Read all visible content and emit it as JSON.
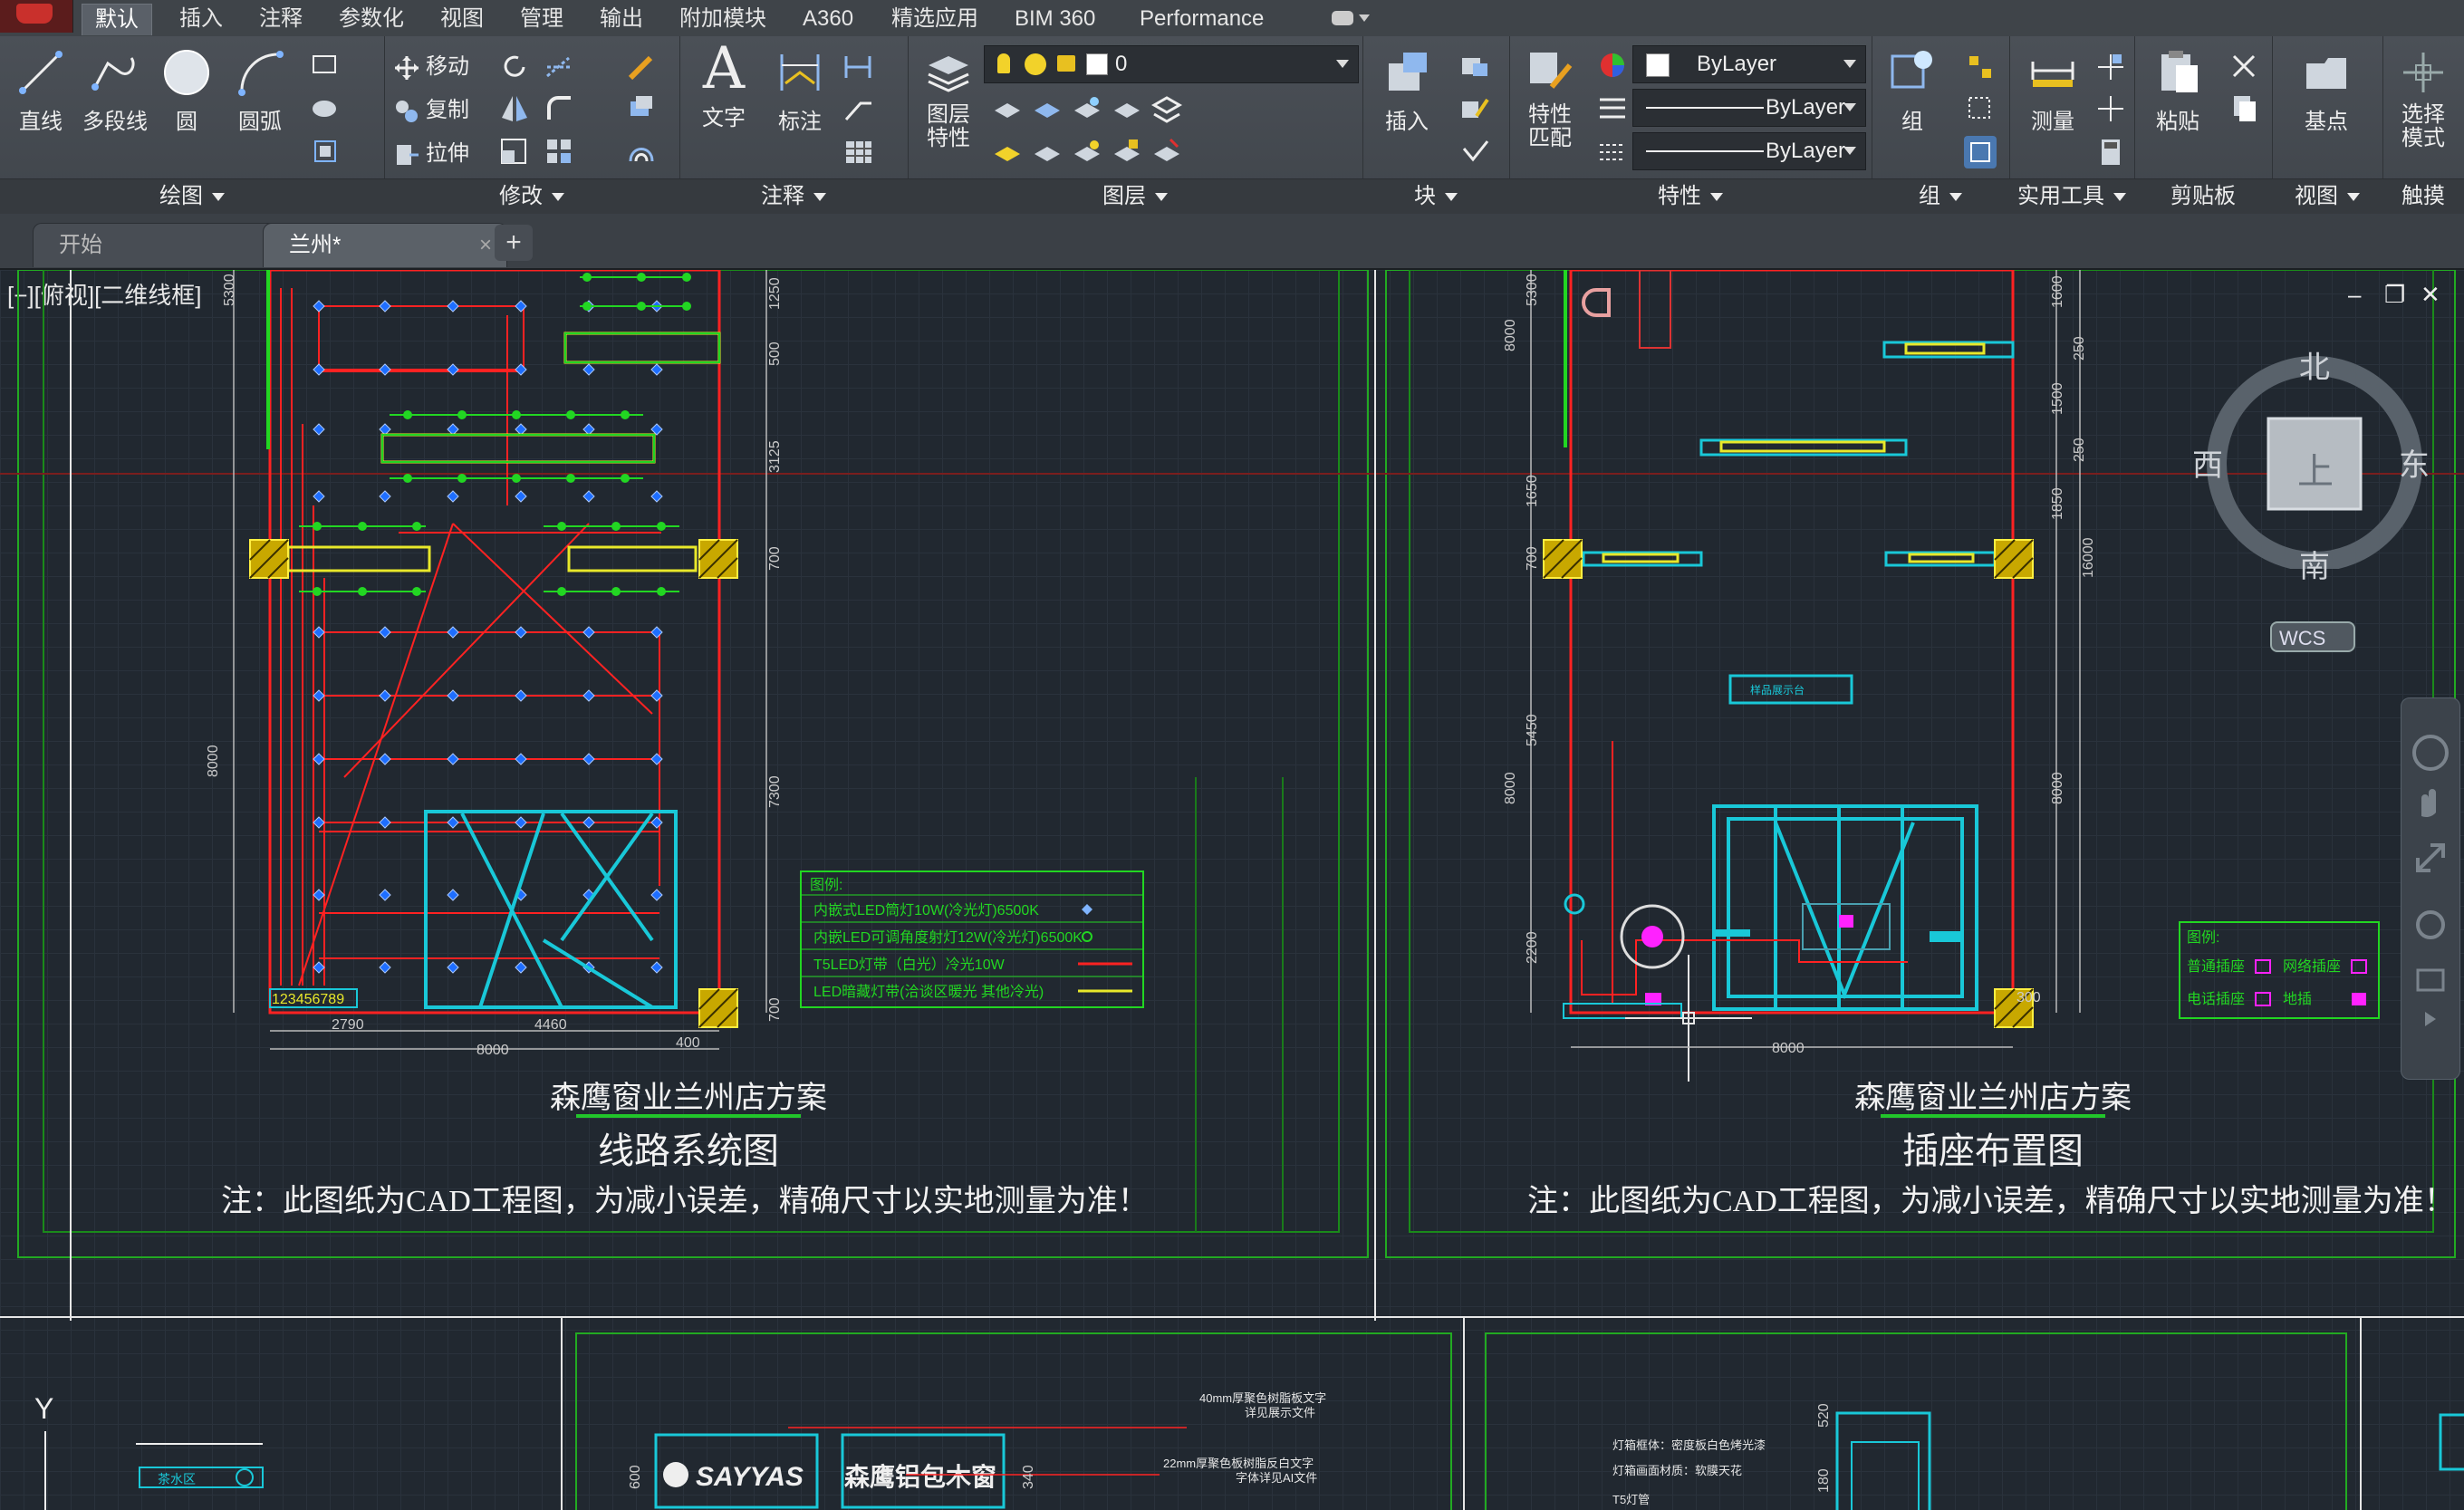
{
  "menubar": {
    "tabs": [
      "默认",
      "插入",
      "注释",
      "参数化",
      "视图",
      "管理",
      "输出",
      "附加模块",
      "A360",
      "精选应用",
      "BIM 360",
      "Performance"
    ],
    "active_tab": "默认"
  },
  "ribbon": {
    "draw": {
      "title": "绘图",
      "line": "直线",
      "polyline": "多段线",
      "circle": "圆",
      "arc": "圆弧"
    },
    "modify": {
      "title": "修改",
      "move": "移动",
      "copy": "复制",
      "stretch": "拉伸"
    },
    "annotation": {
      "title": "注释",
      "text": "文字",
      "dimension": "标注"
    },
    "layers": {
      "title": "图层",
      "layer_props": "图层\n特性",
      "current_layer": "0"
    },
    "block": {
      "title": "块",
      "insert": "插入"
    },
    "properties": {
      "title": "特性",
      "match": "特性\n匹配",
      "color": "ByLayer",
      "linetype": "ByLayer",
      "lineweight": "ByLayer"
    },
    "groups": {
      "title": "组",
      "group": "组"
    },
    "utilities": {
      "title": "实用工具",
      "measure": "测量"
    },
    "clipboard": {
      "title": "剪贴板",
      "paste": "粘贴"
    },
    "view": {
      "title": "视图",
      "base": "基点"
    },
    "touch": {
      "title": "触摸",
      "select_mode": "选择\n模式"
    }
  },
  "filetabs": {
    "start": "开始",
    "drawing": "兰州*",
    "close": "×",
    "add": "+"
  },
  "viewport": {
    "label": "[−][俯视][二维线框]"
  },
  "viewcube": {
    "north": "北",
    "south": "南",
    "east": "东",
    "west": "西",
    "top": "上",
    "wcs": "WCS"
  },
  "sheets": [
    {
      "project": "森鹰窗业兰州店方案",
      "subtitle": "线路系统图",
      "note": "注：此图纸为CAD工程图，为减小误差，精确尺寸以实地测量为准！",
      "legend_title": "图例:",
      "legend_items": [
        "内嵌式LED筒灯10W(冷光灯)6500K",
        "内嵌LED可调角度射灯12W(冷光灯)6500K",
        "T5LED灯带（白光）冷光10W",
        "LED暗藏灯带(洽谈区暖光 其他冷光)"
      ],
      "dims_left": [
        "5300",
        "8000"
      ],
      "dims_right": [
        "1250",
        "500",
        "3125",
        "700",
        "7300",
        "700"
      ],
      "dims_bottom": [
        "2790",
        "4460",
        "8000",
        "400"
      ],
      "tag": "123456789"
    },
    {
      "project": "森鹰窗业兰州店方案",
      "subtitle": "插座布置图",
      "note": "注：此图纸为CAD工程图，为减小误差，精确尺寸以实地测量为准！",
      "legend_title": "图例:",
      "legend_items": [
        "普通插座",
        "网络插座",
        "电话插座",
        "地插"
      ],
      "dims_left": [
        "5300",
        "8000",
        "1650",
        "700",
        "5450",
        "8000",
        "2200"
      ],
      "dims_right": [
        "1600",
        "250",
        "1500",
        "250",
        "1850",
        "16000",
        "8000",
        "300"
      ],
      "dims_bottom": [
        "8000"
      ],
      "booth_label": "样品展示台"
    }
  ],
  "bottom_strip": {
    "axis_y": "Y",
    "area_label": "茶水区",
    "logo_a": "SAYYAS",
    "logo_b": "森鹰铝包木窗",
    "dims": [
      "600",
      "340",
      "520",
      "180"
    ],
    "notes": [
      "40mm厚聚色树脂板文字",
      "详见展示文件",
      "22mm厚聚色板树脂反白文字",
      "字体详见AI文件",
      "灯箱框体：密度板白色烤光漆",
      "灯箱画面材质：软膜天花",
      "T5灯管"
    ]
  },
  "colors": {
    "red": "#ff2222",
    "cyan": "#19c8d8",
    "yellow": "#e8e82a",
    "green": "#22d622",
    "magenta": "#ff22ff",
    "grid": "#2a323c"
  }
}
